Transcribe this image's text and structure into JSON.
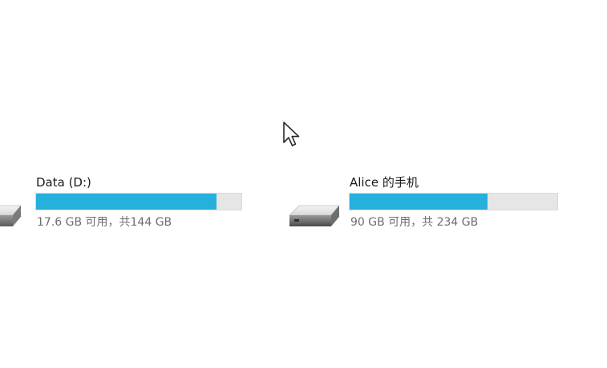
{
  "drives": [
    {
      "name": "Data (D:)",
      "space_text": "17.6 GB 可用，共144 GB",
      "used_fraction": 0.878
    },
    {
      "name": "Alice 的手机",
      "space_text": "90 GB 可用，共 234 GB",
      "used_fraction": 0.665
    }
  ],
  "colors": {
    "bar_fill": "#26b0dc",
    "bar_track": "#e6e6e6",
    "label": "#1a1a1a",
    "subtext": "#6d6d6d"
  },
  "icons": {
    "drive": "hard-drive-icon",
    "cursor": "mouse-pointer-icon"
  }
}
